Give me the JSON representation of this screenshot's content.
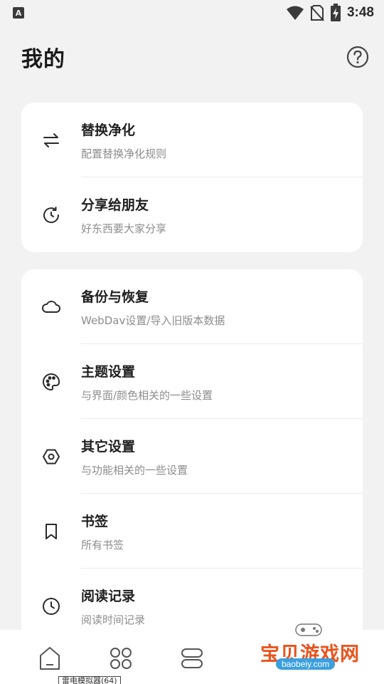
{
  "status_bar": {
    "notification_glyph": "A",
    "time": "3:48",
    "icons": [
      "wifi-icon",
      "no-sim-icon",
      "battery-charging-icon"
    ]
  },
  "header": {
    "title": "我的",
    "help_icon": "help-circle-icon"
  },
  "group_1": [
    {
      "icon": "swap-arrows-icon",
      "title": "替换净化",
      "subtitle": "配置替换净化规则"
    },
    {
      "icon": "share-rotate-icon",
      "title": "分享给朋友",
      "subtitle": "好东西要大家分享"
    }
  ],
  "group_2": [
    {
      "icon": "cloud-icon",
      "title": "备份与恢复",
      "subtitle": "WebDav设置/导入旧版本数据"
    },
    {
      "icon": "palette-icon",
      "title": "主题设置",
      "subtitle": "与界面/颜色相关的一些设置"
    },
    {
      "icon": "hexagon-settings-icon",
      "title": "其它设置",
      "subtitle": "与功能相关的一些设置"
    },
    {
      "icon": "bookmark-icon",
      "title": "书签",
      "subtitle": "所有书签"
    },
    {
      "icon": "clock-icon",
      "title": "阅读记录",
      "subtitle": "阅读时间记录"
    }
  ],
  "bottom_nav": [
    "home-icon",
    "discover-icon",
    "layers-icon"
  ],
  "overlay_tag": "雷电模拟器(64)",
  "watermark": {
    "text": "宝贝游戏网",
    "domain": "baobeiy.com"
  },
  "colors": {
    "background": "#f2f2f2",
    "card": "#ffffff",
    "watermark": "#e8541e"
  }
}
